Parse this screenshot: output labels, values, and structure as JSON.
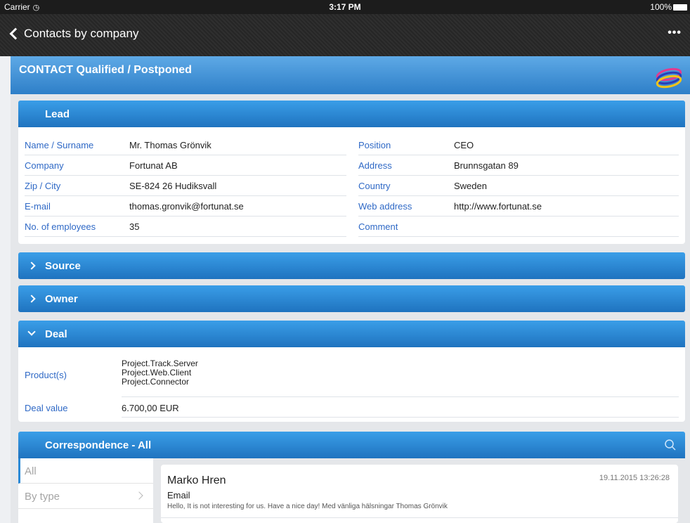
{
  "status_bar": {
    "carrier": "Carrier",
    "time": "3:17 PM",
    "battery": "100%"
  },
  "nav": {
    "back_label": "Contacts by company",
    "more_label": "•••"
  },
  "header": {
    "title": "CONTACT Qualified / Postponed"
  },
  "lead": {
    "title": "Lead",
    "left": [
      {
        "label": "Name / Surname",
        "value": "Mr. Thomas Grönvik"
      },
      {
        "label": "Company",
        "value": "Fortunat AB"
      },
      {
        "label": "Zip / City",
        "value": "SE-824 26 Hudiksvall"
      },
      {
        "label": "E-mail",
        "value": "thomas.gronvik@fortunat.se"
      },
      {
        "label": "No. of employees",
        "value": "35"
      }
    ],
    "right": [
      {
        "label": "Position",
        "value": "CEO"
      },
      {
        "label": "Address",
        "value": "Brunnsgatan 89"
      },
      {
        "label": "Country",
        "value": "Sweden"
      },
      {
        "label": "Web address",
        "value": "http://www.fortunat.se"
      },
      {
        "label": "Comment",
        "value": ""
      }
    ]
  },
  "source": {
    "title": "Source"
  },
  "owner": {
    "title": "Owner"
  },
  "deal": {
    "title": "Deal",
    "products_label": "Product(s)",
    "products": [
      "Project.Track.Server",
      "Project.Web.Client",
      "Project.Connector"
    ],
    "value_label": "Deal value",
    "value": "6.700,00 EUR"
  },
  "correspondence": {
    "title": "Correspondence - All",
    "filters": [
      {
        "label": "All"
      },
      {
        "label": "By type"
      }
    ],
    "entry": {
      "sender": "Marko Hren",
      "date": "19.11.2015 13:26:28",
      "type": "Email",
      "snippet": "Hello, It is not interesting for us. Have a nice day! Med vänliga hälsningar Thomas Grönvik"
    }
  },
  "colors": {
    "accent": "#2f69c6",
    "section_bar": "#2a89d6"
  }
}
